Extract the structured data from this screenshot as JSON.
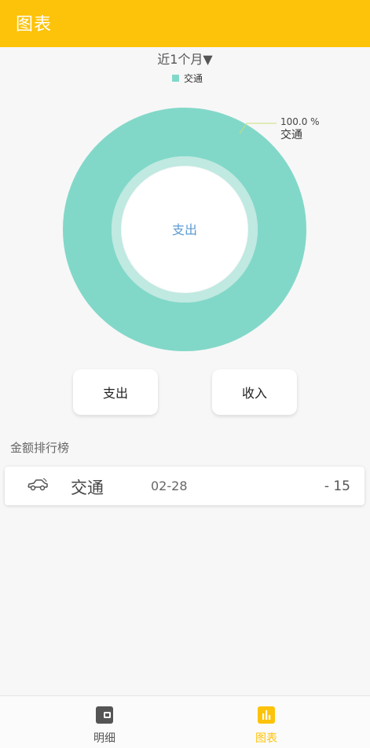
{
  "app": {
    "title": "图表",
    "accent_color": "#fdc30b"
  },
  "filter": {
    "period_label": "近1个月▼"
  },
  "chart_data": {
    "type": "pie",
    "style": "donut",
    "center_label": "支出",
    "legend": [
      {
        "name": "交通",
        "color": "#82d8c8"
      }
    ],
    "slices": [
      {
        "label": "交通",
        "value": 15,
        "percent_label": "100.0 %",
        "color": "#82d8c8"
      }
    ]
  },
  "toggle": {
    "expense_label": "支出",
    "income_label": "收入"
  },
  "ranking": {
    "title": "金额排行榜",
    "items": [
      {
        "icon": "car-icon",
        "category": "交通",
        "date": "02-28",
        "amount": "- 15"
      }
    ]
  },
  "nav": {
    "items": [
      {
        "icon": "wallet-icon",
        "label": "明细",
        "active": false
      },
      {
        "icon": "bar-chart-icon",
        "label": "图表",
        "active": true
      }
    ]
  }
}
